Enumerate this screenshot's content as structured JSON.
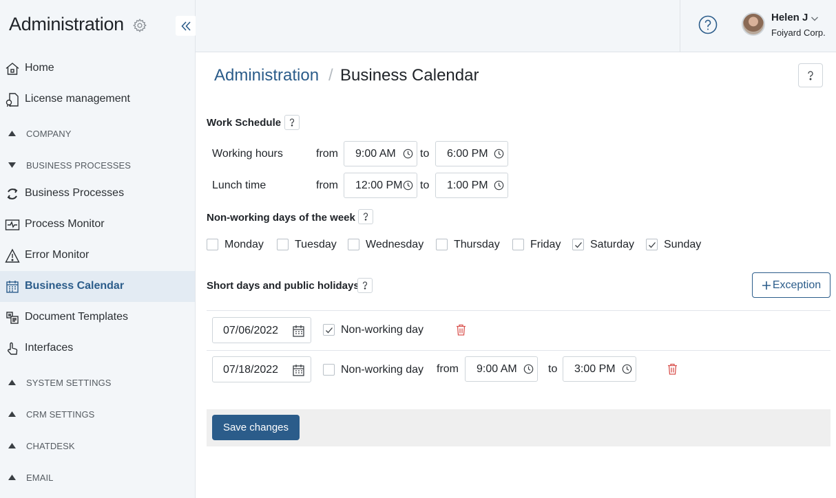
{
  "sidebar": {
    "title": "Administration",
    "items": [
      {
        "label": "Home",
        "icon": "home-icon"
      },
      {
        "label": "License management",
        "icon": "license-icon"
      },
      {
        "label": "Business Processes",
        "icon": "process-cycle-icon"
      },
      {
        "label": "Process Monitor",
        "icon": "monitor-icon"
      },
      {
        "label": "Error Monitor",
        "icon": "warning-icon"
      },
      {
        "label": "Business Calendar",
        "icon": "calendar-icon",
        "active": true
      },
      {
        "label": "Document Templates",
        "icon": "document-template-icon"
      },
      {
        "label": "Interfaces",
        "icon": "pointer-hand-icon"
      }
    ],
    "sections": [
      {
        "label": "COMPANY",
        "state": "collapsed"
      },
      {
        "label": "BUSINESS PROCESSES",
        "state": "expanded"
      },
      {
        "label": "SYSTEM SETTINGS",
        "state": "collapsed"
      },
      {
        "label": "CRM SETTINGS",
        "state": "collapsed"
      },
      {
        "label": "CHATDESK",
        "state": "collapsed"
      },
      {
        "label": "EMAIL",
        "state": "collapsed"
      }
    ]
  },
  "header": {
    "user_name": "Helen J",
    "user_org": "Foiyard Corp."
  },
  "breadcrumb": {
    "parent": "Administration",
    "separator": "/",
    "current": "Business Calendar"
  },
  "work_schedule": {
    "title": "Work Schedule",
    "from_label": "from",
    "to_label": "to",
    "working_hours": {
      "label": "Working hours",
      "from": "9:00 AM",
      "to": "6:00 PM"
    },
    "lunch_time": {
      "label": "Lunch time",
      "from": "12:00 PM",
      "to": "1:00 PM"
    }
  },
  "non_working_days": {
    "title": "Non-working days of the week",
    "days": [
      {
        "label": "Monday",
        "checked": false
      },
      {
        "label": "Tuesday",
        "checked": false
      },
      {
        "label": "Wednesday",
        "checked": false
      },
      {
        "label": "Thursday",
        "checked": false
      },
      {
        "label": "Friday",
        "checked": false
      },
      {
        "label": "Saturday",
        "checked": true
      },
      {
        "label": "Sunday",
        "checked": true
      }
    ]
  },
  "holidays": {
    "title": "Short days and public holidays",
    "exception_button": "Exception",
    "non_working_label": "Non-working day",
    "from_label": "from",
    "to_label": "to",
    "rows": [
      {
        "date": "07/06/2022",
        "non_working": true
      },
      {
        "date": "07/18/2022",
        "non_working": false,
        "from": "9:00 AM",
        "to": "3:00 PM"
      }
    ]
  },
  "footer": {
    "save_label": "Save changes"
  },
  "colors": {
    "accent": "#2b5c8a",
    "delete": "#d9534f",
    "sidebar_bg": "#f3f6f9"
  }
}
